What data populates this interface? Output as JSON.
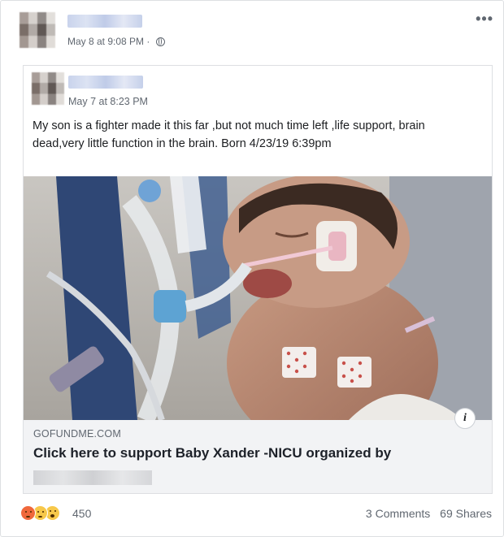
{
  "post": {
    "timestamp": "May 8 at 9:08 PM · ",
    "more_label": "•••",
    "privacy_icon": "globe-icon"
  },
  "shared_post": {
    "timestamp": "May 7 at 8:23 PM",
    "text": "My son is a fighter made it this far ,but not much time left ,life support, brain dead,very little function in the brain. Born 4/23/19 6:39pm"
  },
  "link": {
    "domain": "GOFUNDME.COM",
    "headline": "Click here to support Baby Xander -NICU organized by",
    "info_label": "i"
  },
  "footer": {
    "reaction_count": "450",
    "comments": "3 Comments",
    "shares": "69 Shares",
    "reaction_icons": [
      "angry-reaction-icon",
      "sad-reaction-icon",
      "wow-reaction-icon"
    ]
  },
  "colors": {
    "meta_text": "#606770",
    "link_bg": "#f2f3f5",
    "angry": "#f0683b",
    "sad_wow": "#f7c84a"
  }
}
